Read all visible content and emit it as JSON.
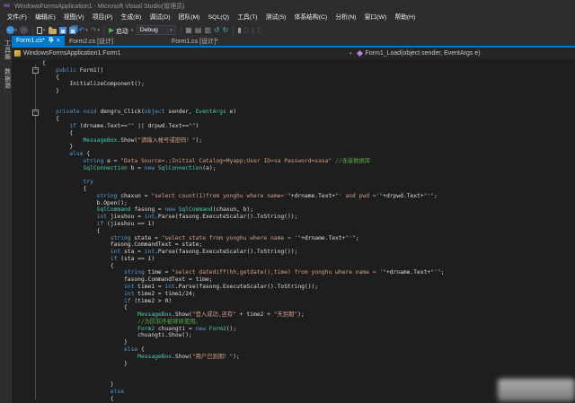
{
  "window": {
    "title": "WindowsFormsApplication1 - Microsoft Visual Studio(管理员)"
  },
  "menu": {
    "items": [
      "文件(F)",
      "编辑(E)",
      "视图(V)",
      "项目(P)",
      "生成(B)",
      "调试(D)",
      "团队(M)",
      "SQL(Q)",
      "工具(T)",
      "测试(S)",
      "体系结构(C)",
      "分析(N)",
      "窗口(W)",
      "帮助(H)"
    ]
  },
  "toolbar": {
    "start_label": "启动",
    "config": "Debug"
  },
  "side_tabs": [
    "工具箱",
    "数据源"
  ],
  "tabs": [
    {
      "label": "Form1.cs*",
      "active": true
    },
    {
      "label": "Form2.cs [设计]",
      "active": false
    },
    {
      "label": "Form1.cs [设计]*",
      "active": false,
      "gap": true
    }
  ],
  "breadcrumb": {
    "left": "WindowsFormsApplication1.Form1",
    "right": "Form1_Load(object sender, EventArgs e)"
  },
  "colors": {
    "accent": "#007acc",
    "editor_bg": "#1e1e1e",
    "chrome_bg": "#2d2d30",
    "keyword": "#569cd6",
    "type": "#4ec9b0",
    "string": "#d69d85",
    "comment": "#57a64a"
  },
  "editor": {
    "lines": [
      [
        [
          "p",
          "{"
        ]
      ],
      [
        [
          "p",
          "    "
        ],
        [
          "k",
          "public"
        ],
        [
          "p",
          " Form1()"
        ]
      ],
      [
        [
          "p",
          "    {"
        ]
      ],
      [
        [
          "p",
          "        InitializeComponent();"
        ]
      ],
      [
        [
          "p",
          "    }"
        ]
      ],
      [],
      [],
      [
        [
          "p",
          "    "
        ],
        [
          "k",
          "private"
        ],
        [
          "p",
          " "
        ],
        [
          "k",
          "void"
        ],
        [
          "p",
          " dengru_Click("
        ],
        [
          "k",
          "object"
        ],
        [
          "p",
          " sender, "
        ],
        [
          "t",
          "EventArgs"
        ],
        [
          "p",
          " e)"
        ]
      ],
      [
        [
          "p",
          "    {"
        ]
      ],
      [
        [
          "p",
          "        "
        ],
        [
          "k",
          "if"
        ],
        [
          "p",
          " (drname.Text=="
        ],
        [
          "s",
          "\"\""
        ],
        [
          "p",
          " || drpwd.Text=="
        ],
        [
          "s",
          "\"\""
        ],
        [
          "p",
          ")"
        ]
      ],
      [
        [
          "p",
          "        {"
        ]
      ],
      [
        [
          "p",
          "            "
        ],
        [
          "t",
          "MessageBox"
        ],
        [
          "p",
          ".Show("
        ],
        [
          "s",
          "\"请输入帐号或密码！\""
        ],
        [
          "p",
          ");"
        ]
      ],
      [
        [
          "p",
          "        }"
        ]
      ],
      [
        [
          "p",
          "        "
        ],
        [
          "k",
          "else"
        ],
        [
          "p",
          " {"
        ]
      ],
      [
        [
          "p",
          "            "
        ],
        [
          "k",
          "string"
        ],
        [
          "p",
          " a = "
        ],
        [
          "s",
          "\"Data Source=.;Initial Catalog=Myapp;User ID=sa Password=sasa\""
        ],
        [
          "p",
          " "
        ],
        [
          "c",
          "//连接数据库"
        ]
      ],
      [
        [
          "p",
          "            "
        ],
        [
          "t",
          "SqlConnection"
        ],
        [
          "p",
          " b = "
        ],
        [
          "k",
          "new"
        ],
        [
          "p",
          " "
        ],
        [
          "t",
          "SqlConnection"
        ],
        [
          "p",
          "(a);"
        ]
      ],
      [],
      [
        [
          "p",
          "            "
        ],
        [
          "k",
          "try"
        ]
      ],
      [
        [
          "p",
          "            {"
        ]
      ],
      [
        [
          "p",
          "                "
        ],
        [
          "k",
          "string"
        ],
        [
          "p",
          " chaxun = "
        ],
        [
          "s",
          "\"select count(1)from yonghu where name='\""
        ],
        [
          "p",
          "+drname.Text+"
        ],
        [
          "s",
          "\"' and pwd ='\""
        ],
        [
          "p",
          "+drpwd.Text+"
        ],
        [
          "s",
          "\"'\""
        ],
        [
          "p",
          ";"
        ]
      ],
      [
        [
          "p",
          "                b.Open();"
        ]
      ],
      [
        [
          "p",
          "                "
        ],
        [
          "t",
          "SqlCommand"
        ],
        [
          "p",
          " fasong = "
        ],
        [
          "k",
          "new"
        ],
        [
          "p",
          " "
        ],
        [
          "t",
          "SqlCommand"
        ],
        [
          "p",
          "(chaxun, b);"
        ]
      ],
      [
        [
          "p",
          "                "
        ],
        [
          "k",
          "int"
        ],
        [
          "p",
          " jieshou = "
        ],
        [
          "k",
          "int"
        ],
        [
          "p",
          ".Parse(fasong.ExecuteScalar().ToString());"
        ]
      ],
      [
        [
          "p",
          "                "
        ],
        [
          "k",
          "if"
        ],
        [
          "p",
          " (jieshou == 1)"
        ]
      ],
      [
        [
          "p",
          "                {"
        ]
      ],
      [
        [
          "p",
          "                    "
        ],
        [
          "k",
          "string"
        ],
        [
          "p",
          " state = "
        ],
        [
          "s",
          "\"select state from yonghu where name = '\""
        ],
        [
          "p",
          "+drname.Text+"
        ],
        [
          "s",
          "\"'\""
        ],
        [
          "p",
          ";"
        ]
      ],
      [
        [
          "p",
          "                    fasong.CommandText = state;"
        ]
      ],
      [
        [
          "p",
          "                    "
        ],
        [
          "k",
          "int"
        ],
        [
          "p",
          " sta = "
        ],
        [
          "k",
          "int"
        ],
        [
          "p",
          ".Parse(fasong.ExecuteScalar().ToString());"
        ]
      ],
      [
        [
          "p",
          "                    "
        ],
        [
          "k",
          "if"
        ],
        [
          "p",
          " (sta == 1)"
        ]
      ],
      [
        [
          "p",
          "                    {"
        ]
      ],
      [
        [
          "p",
          "                        "
        ],
        [
          "k",
          "string"
        ],
        [
          "p",
          " time = "
        ],
        [
          "s",
          "\"select datediff(hh,getdate(),time) from yonghu where name = '\""
        ],
        [
          "p",
          "+drname.Text+"
        ],
        [
          "s",
          "\"'\""
        ],
        [
          "p",
          ";"
        ]
      ],
      [
        [
          "p",
          "                        fasong.CommandText = time;"
        ]
      ],
      [
        [
          "p",
          "                        "
        ],
        [
          "k",
          "int"
        ],
        [
          "p",
          " time1 = "
        ],
        [
          "k",
          "int"
        ],
        [
          "p",
          ".Parse(fasong.ExecuteScalar().ToString());"
        ]
      ],
      [
        [
          "p",
          "                        "
        ],
        [
          "k",
          "int"
        ],
        [
          "p",
          " time2 = time1/24;"
        ]
      ],
      [
        [
          "p",
          "                        "
        ],
        [
          "k",
          "if"
        ],
        [
          "p",
          " (time2 > 0)"
        ]
      ],
      [
        [
          "p",
          "                        {"
        ]
      ],
      [
        [
          "p",
          "                            "
        ],
        [
          "t",
          "MessageBox"
        ],
        [
          "p",
          ".Show("
        ],
        [
          "s",
          "\"登入成功,还有\""
        ],
        [
          "p",
          " + time2 + "
        ],
        [
          "s",
          "\"天到期\""
        ],
        [
          "p",
          ");"
        ]
      ],
      [
        [
          "p",
          "                            "
        ],
        [
          "c",
          "//为防软件被继续使用。"
        ]
      ],
      [
        [
          "p",
          "                            "
        ],
        [
          "t",
          "Form2"
        ],
        [
          "p",
          " chuangti = "
        ],
        [
          "k",
          "new"
        ],
        [
          "p",
          " "
        ],
        [
          "t",
          "Form2"
        ],
        [
          "p",
          "();"
        ]
      ],
      [
        [
          "p",
          "                            chuangti.Show();"
        ]
      ],
      [
        [
          "p",
          "                        }"
        ]
      ],
      [
        [
          "p",
          "                        "
        ],
        [
          "k",
          "else"
        ],
        [
          "p",
          " {"
        ]
      ],
      [
        [
          "p",
          "                            "
        ],
        [
          "t",
          "MessageBox"
        ],
        [
          "p",
          ".Show("
        ],
        [
          "s",
          "\"用户已到期！\""
        ],
        [
          "p",
          ");"
        ]
      ],
      [
        [
          "p",
          "                        }"
        ]
      ],
      [],
      [],
      [
        [
          "p",
          "                    }"
        ]
      ],
      [
        [
          "p",
          "                    "
        ],
        [
          "k",
          "else"
        ]
      ],
      [
        [
          "p",
          "                    {"
        ]
      ]
    ]
  }
}
